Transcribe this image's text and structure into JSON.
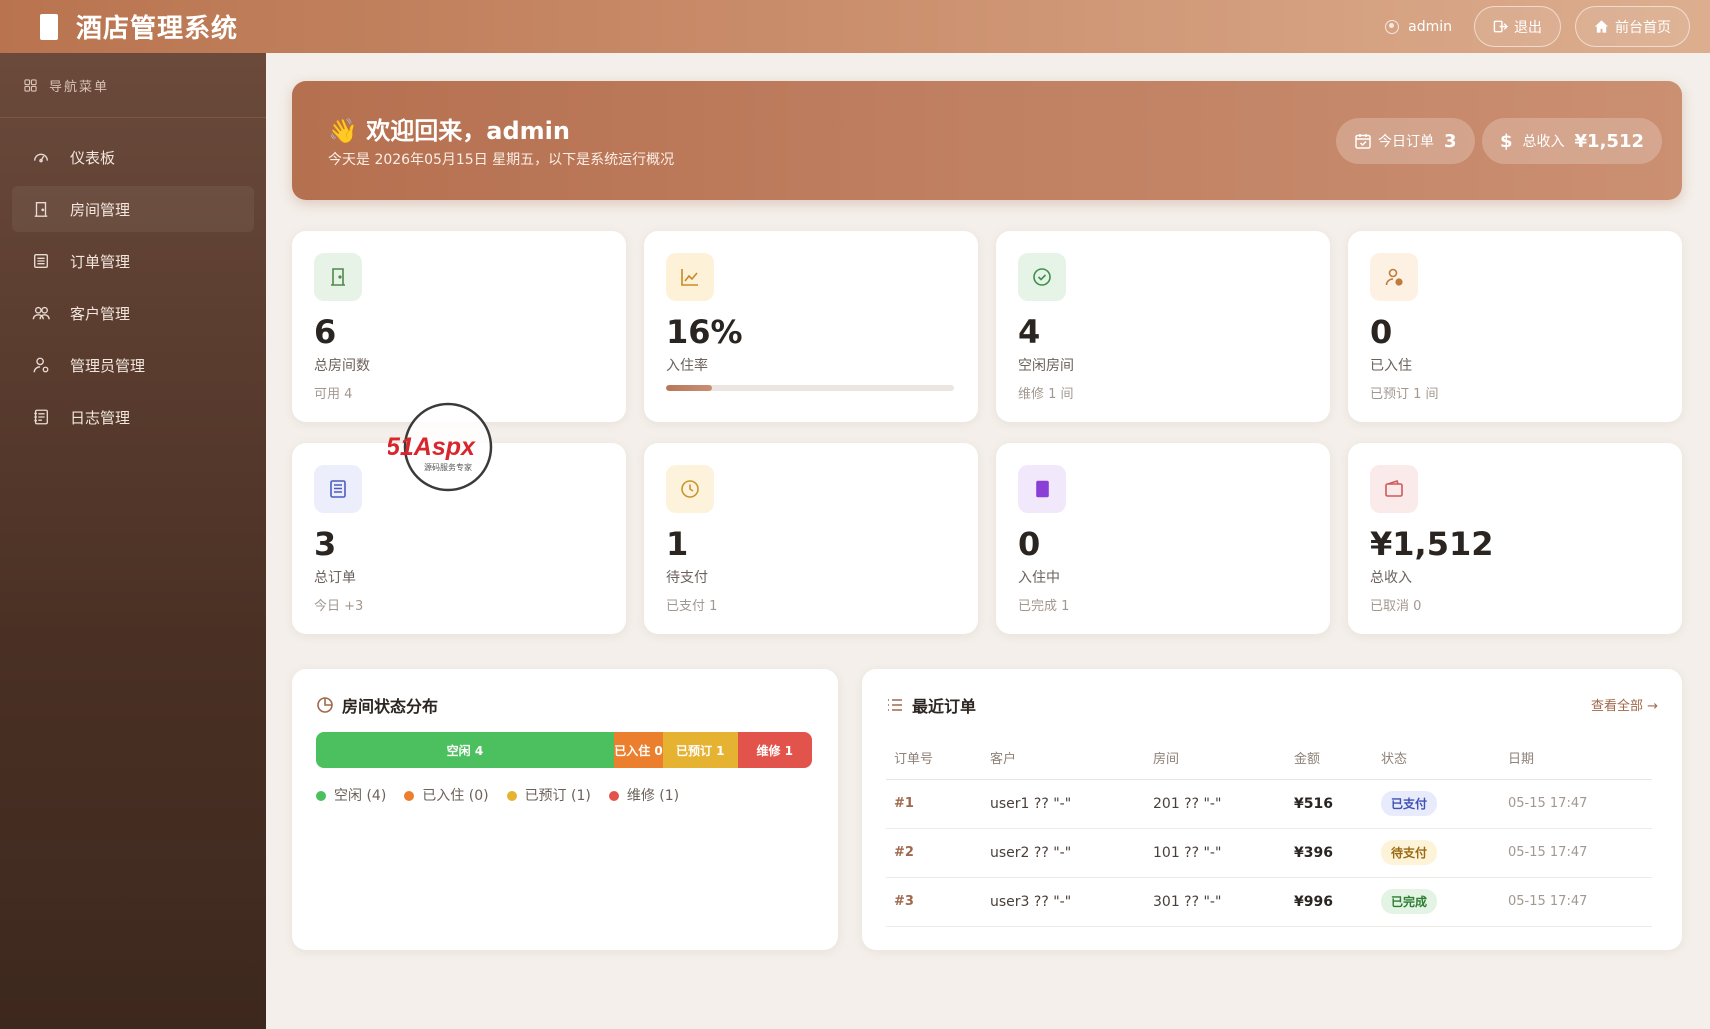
{
  "app": {
    "title": "酒店管理系统"
  },
  "header": {
    "user": "admin",
    "logout_label": "退出",
    "frontpage_label": "前台首页"
  },
  "sidebar": {
    "heading": "导航菜单",
    "items": [
      {
        "label": "仪表板",
        "icon": "dashboard-icon"
      },
      {
        "label": "房间管理",
        "icon": "door-icon"
      },
      {
        "label": "订单管理",
        "icon": "order-icon"
      },
      {
        "label": "客户管理",
        "icon": "customers-icon"
      },
      {
        "label": "管理员管理",
        "icon": "admin-icon"
      },
      {
        "label": "日志管理",
        "icon": "log-icon"
      }
    ]
  },
  "welcome": {
    "emoji": "👋",
    "title": "欢迎回来，admin",
    "subtitle": "今天是 2026年05月15日 星期五，以下是系统运行概况",
    "today_orders_label": "今日订单",
    "today_orders_value": "3",
    "revenue_symbol": "$",
    "revenue_label": "总收入",
    "revenue_value": "¥1,512"
  },
  "stats": [
    {
      "value": "6",
      "label": "总房间数",
      "sub": "可用 4"
    },
    {
      "value": "16%",
      "label": "入住率",
      "progress": 16
    },
    {
      "value": "4",
      "label": "空闲房间",
      "sub": "维修 1 间"
    },
    {
      "value": "0",
      "label": "已入住",
      "sub": "已预订 1 间"
    },
    {
      "value": "3",
      "label": "总订单",
      "sub": "今日 +3"
    },
    {
      "value": "1",
      "label": "待支付",
      "sub": "已支付 1"
    },
    {
      "value": "0",
      "label": "入住中",
      "sub": "已完成 1"
    },
    {
      "value": "¥1,512",
      "label": "总收入",
      "sub": "已取消 0"
    }
  ],
  "watermark": {
    "brand": "51Aspx",
    "tagline": "源码服务专家"
  },
  "room_status": {
    "title": "房间状态分布",
    "segments": [
      {
        "label": "空闲 4",
        "count": 4,
        "color": "#4cbf5e"
      },
      {
        "label": "已入住 0",
        "count": 0,
        "color": "#ec7f2d"
      },
      {
        "label": "已预订 1",
        "count": 1,
        "color": "#e6b232"
      },
      {
        "label": "维修 1",
        "count": 1,
        "color": "#e2544b"
      }
    ],
    "legend": [
      {
        "label": "空闲 (4)",
        "color": "#4cbf5e"
      },
      {
        "label": "已入住 (0)",
        "color": "#ec7f2d"
      },
      {
        "label": "已预订 (1)",
        "color": "#e6b232"
      },
      {
        "label": "维修 (1)",
        "color": "#e2544b"
      }
    ]
  },
  "recent_orders": {
    "title": "最近订单",
    "view_all": "查看全部 →",
    "columns": [
      "订单号",
      "客户",
      "房间",
      "金额",
      "状态",
      "日期"
    ],
    "rows": [
      {
        "id": "#1",
        "customer": "user1 ?? \"-\"",
        "room": "201 ?? \"-\"",
        "amount": "¥516",
        "status": "已支付",
        "status_color": "#3f51b5",
        "status_bg": "#e8ebfb",
        "date": "05-15 17:47"
      },
      {
        "id": "#2",
        "customer": "user2 ?? \"-\"",
        "room": "101 ?? \"-\"",
        "amount": "¥396",
        "status": "待支付",
        "status_color": "#9a6a12",
        "status_bg": "#fdf3d9",
        "date": "05-15 17:47"
      },
      {
        "id": "#3",
        "customer": "user3 ?? \"-\"",
        "room": "301 ?? \"-\"",
        "amount": "¥996",
        "status": "已完成",
        "status_color": "#2e7d32",
        "status_bg": "#e3f4e4",
        "date": "05-15 17:47"
      }
    ]
  }
}
